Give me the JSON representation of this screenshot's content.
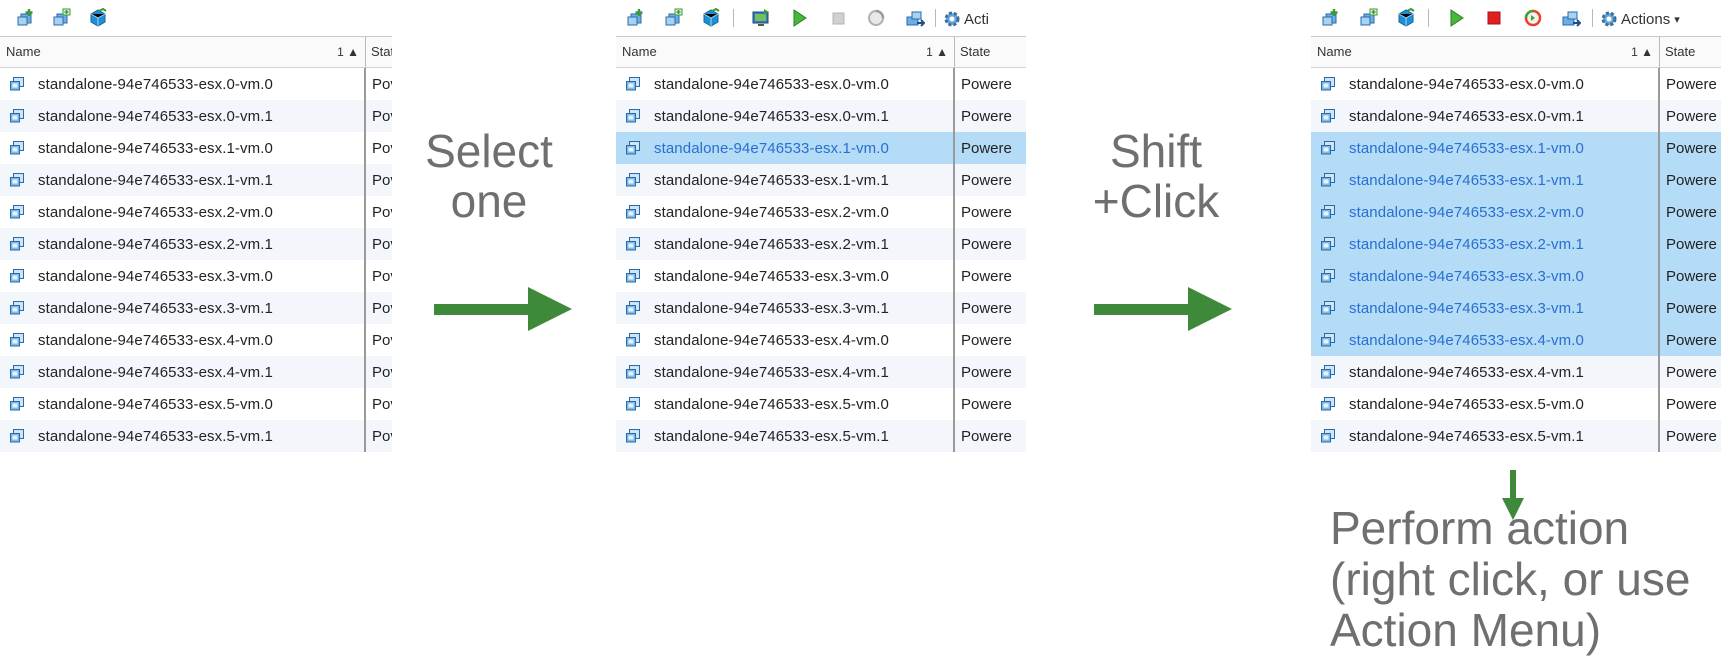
{
  "colors": {
    "selection": "#b5dcf7",
    "selected_text": "#2a6ed1",
    "arrow": "#3f8a3a",
    "caption": "#6f6f6f"
  },
  "captions": {
    "step1": [
      "Select",
      "one"
    ],
    "step2": [
      "Shift",
      "+Click"
    ],
    "step3": [
      "Perform action",
      "(right click, or use",
      "Action Menu)"
    ]
  },
  "grid": {
    "name_header": "Name",
    "sort_indicator": "1 ▲",
    "state_header_full": "State",
    "state_header_p1": "Stat",
    "actions_label": "Actions",
    "actions_label_p2": "Acti",
    "state_value_full": "Powere",
    "state_value_p1": "Pov",
    "vms": [
      "standalone-94e746533-esx.0-vm.0",
      "standalone-94e746533-esx.0-vm.1",
      "standalone-94e746533-esx.1-vm.0",
      "standalone-94e746533-esx.1-vm.1",
      "standalone-94e746533-esx.2-vm.0",
      "standalone-94e746533-esx.2-vm.1",
      "standalone-94e746533-esx.3-vm.0",
      "standalone-94e746533-esx.3-vm.1",
      "standalone-94e746533-esx.4-vm.0",
      "standalone-94e746533-esx.4-vm.1",
      "standalone-94e746533-esx.5-vm.0",
      "standalone-94e746533-esx.5-vm.1"
    ]
  },
  "panels": [
    {
      "selected": []
    },
    {
      "selected": [
        2
      ]
    },
    {
      "selected": [
        2,
        3,
        4,
        5,
        6,
        7,
        8
      ]
    }
  ]
}
